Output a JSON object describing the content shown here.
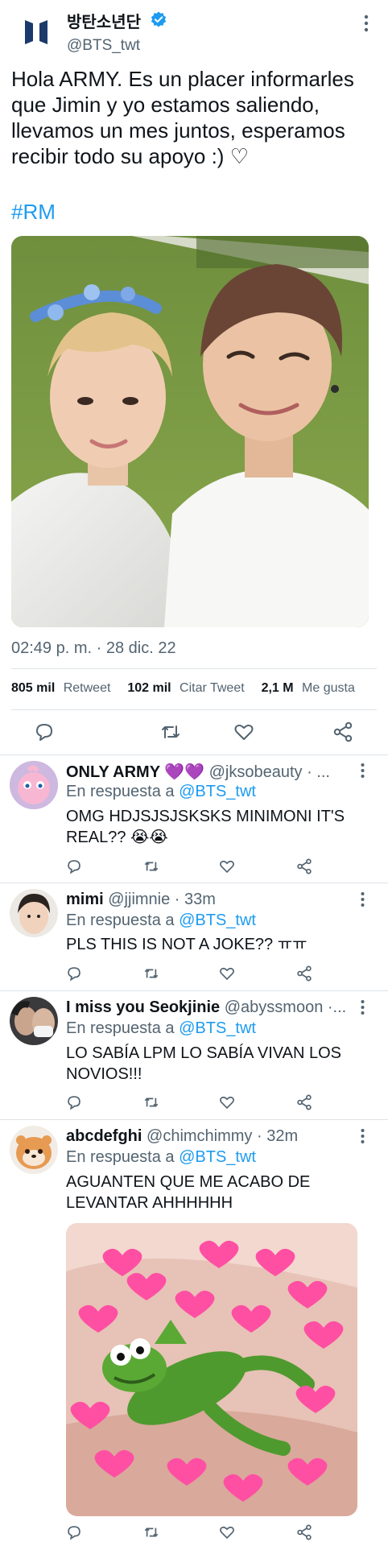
{
  "account": {
    "name": "방탄소년단",
    "handle": "@BTS_twt",
    "verified": true,
    "logo_icon": "bts-logo-icon"
  },
  "tweet": {
    "text": "Hola ARMY. Es un placer informarles que Jimin y yo estamos saliendo, llevamos un mes juntos, esperamos recibir todo su apoyo :) ♡",
    "hashtag": "#RM",
    "timestamp": "02:49 p. m. · 28 dic. 22",
    "stats": {
      "retweets_value": "805 mil",
      "retweets_label": "Retweet",
      "quotes_value": "102 mil",
      "quotes_label": "Citar Tweet",
      "likes_value": "2,1 M",
      "likes_label": "Me gusta"
    },
    "actions": [
      "reply-icon",
      "retweet-icon",
      "like-icon",
      "share-icon"
    ]
  },
  "replies": [
    {
      "name": "ONLY ARMY 💜💜",
      "handle": "@jksobeauty · ...",
      "reply_prefix": "En respuesta a",
      "reply_to": "@BTS_twt",
      "text": "OMG HDJSJSJSKSKS MINIMONI IT'S REAL?? 😭😭"
    },
    {
      "name": "mimi",
      "handle": "@jjimnie · 33m",
      "reply_prefix": "En respuesta a",
      "reply_to": "@BTS_twt",
      "text": "PLS THIS IS NOT A JOKE?? ㅠㅠ"
    },
    {
      "name": "I miss you Seokjinie",
      "handle": "@abyssmoon ·...",
      "reply_prefix": "En respuesta a",
      "reply_to": "@BTS_twt",
      "text": "LO SABÍA LPM LO SABÍA VIVAN LOS NOVIOS!!!"
    },
    {
      "name": "abcdefghi",
      "handle": "@chimchimmy · 32m",
      "reply_prefix": "En respuesta a",
      "reply_to": "@BTS_twt",
      "text": "AGUANTEN QUE ME ACABO DE LEVANTAR AHHHHHH"
    }
  ],
  "colors": {
    "accent": "#1d9bf0",
    "text_primary": "#0f1419",
    "text_secondary": "#536471",
    "divider": "#dfe4e8",
    "logo": "#1a3a6b"
  }
}
